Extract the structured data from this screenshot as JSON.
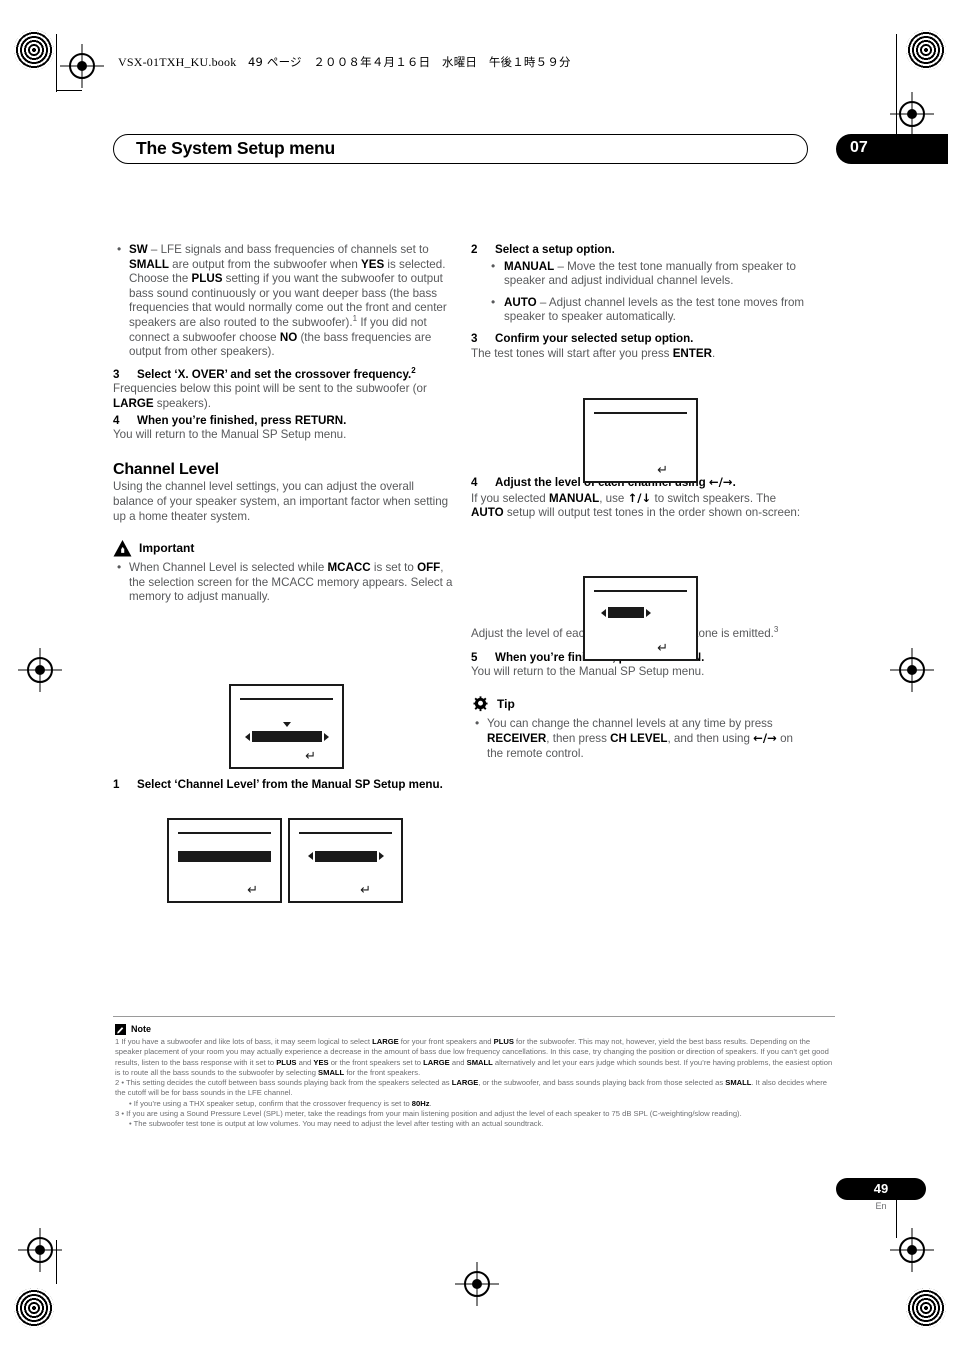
{
  "book_header": {
    "filename": "VSX-01TXH_KU.book",
    "page_label": "49 ページ",
    "date": "２００８年４月１６日　水曜日　午後１時５９分"
  },
  "chapter": {
    "title": "The System Setup menu",
    "number": "07"
  },
  "left_column": {
    "sw_bullet": {
      "term": "SW",
      "text_1": " – LFE signals and bass frequencies of channels set to ",
      "bold_1": "SMALL",
      "text_2": " are output from the subwoofer when ",
      "bold_2": "YES",
      "text_3": " is selected. Choose the ",
      "bold_3": "PLUS",
      "text_4": " setting if you want the subwoofer to output bass sound continuously or you want deeper bass (the bass frequencies that would normally come out the front and center speakers are also routed to the subwoofer).",
      "footnote_ref": "1",
      "text_5": " If you did not connect a subwoofer choose ",
      "bold_4": "NO",
      "text_6": " (the bass frequencies are output from other speakers)."
    },
    "step3": {
      "number": "3",
      "heading": "Select ‘X. OVER’ and set the crossover frequency.",
      "heading_footnote": "2",
      "body_1": "Frequencies below this point will be sent to the subwoofer (or ",
      "body_bold": "LARGE",
      "body_2": " speakers)."
    },
    "step4": {
      "number": "4",
      "heading": "When you’re finished, press RETURN.",
      "body": "You will return to the Manual SP Setup menu."
    },
    "section_title": "Channel Level",
    "section_body": "Using the channel level settings, you can adjust the overall balance of your speaker system, an important factor when setting up a home theater system.",
    "important": {
      "label": "Important",
      "bullet_1": "When Channel Level is selected while ",
      "bullet_bold_1": "MCACC",
      "bullet_2": " is set to ",
      "bullet_bold_2": "OFF",
      "bullet_3": ", the selection screen for the MCACC memory appears. Select a memory to adjust manually."
    },
    "step1": {
      "number": "1",
      "heading": "Select ‘Channel Level’ from the Manual SP Setup menu."
    }
  },
  "right_column": {
    "step2": {
      "number": "2",
      "heading": "Select a setup option.",
      "manual_term": "MANUAL",
      "manual_text": " – Move the test tone manually from speaker to speaker and adjust individual channel levels.",
      "auto_term": "AUTO",
      "auto_text": " – Adjust channel levels as the test tone moves from speaker to speaker automatically."
    },
    "step3": {
      "number": "3",
      "heading": "Confirm your selected setup option.",
      "body_1": "The test tones will start after you press ",
      "body_bold": "ENTER",
      "body_2": "."
    },
    "step4": {
      "number": "4",
      "heading_1": "Adjust the level of each channel using ",
      "heading_arrows": "←/→",
      "heading_2": ".",
      "body_1": "If you selected ",
      "body_bold_1": "MANUAL",
      "body_2": ", use ",
      "body_arrows": "↑/↓",
      "body_3": " to switch speakers. The ",
      "body_bold_2": "AUTO",
      "body_4": " setup will output test tones in the order shown on-screen:"
    },
    "after_screen_1": "Adjust the level of each speaker as the test tone is emitted.",
    "after_screen_1_footnote": "3",
    "step5": {
      "number": "5",
      "heading": "When you’re finished, press RETURN.",
      "body": "You will return to the Manual SP Setup menu."
    },
    "tip": {
      "label": "Tip",
      "bullet_1": "You can change the channel levels at any time by press ",
      "bullet_bold_1": "RECEIVER",
      "bullet_2": ", then press ",
      "bullet_bold_2": "CH LEVEL",
      "bullet_3": ", and then using ",
      "bullet_arrows": "←/→",
      "bullet_4": " on the remote control."
    }
  },
  "footnotes": {
    "label": "Note",
    "n1": {
      "marker": "1",
      "t1": "If you have a subwoofer and like lots of bass, it may seem logical to select ",
      "b1": "LARGE",
      "t2": " for your front speakers and ",
      "b2": "PLUS",
      "t3": " for the subwoofer. This may not, however, yield the best bass results. Depending on the speaker placement of your room you may actually experience a decrease in the amount of bass due low frequency cancellations. In this case, try changing the position or direction of speakers. If you can’t get good results, listen to the bass response with it set to ",
      "b3": "PLUS",
      "t4": " and ",
      "b4": "YES",
      "t5": " or the front speakers set to ",
      "b5": "LARGE",
      "t6": " and ",
      "b6": "SMALL",
      "t7": " alternatively and let your ears judge which sounds best. If you’re having problems, the easiest option is to route all the bass sounds to the subwoofer by selecting ",
      "b7": "SMALL",
      "t8": " for the front speakers."
    },
    "n2": {
      "marker": "2 •",
      "t1": "This setting decides the cutoff between bass sounds playing back from the speakers selected as ",
      "b1": "LARGE",
      "t2": ", or the subwoofer, and bass sounds playing back from those selected as ",
      "b2": "SMALL",
      "t3": ". It also decides where the cutoff will be for bass sounds in the LFE channel."
    },
    "n2b": {
      "t1": "• If you’re using a THX speaker setup, confirm that the crossover frequency is set to ",
      "b1": "80Hz",
      "t2": "."
    },
    "n3": {
      "marker": "3 •",
      "t1": "If you are using a Sound Pressure Level (SPL) meter, take the readings from your main listening position and adjust the level of each speaker to 75 dB SPL (C-weighting/slow reading)."
    },
    "n3b": {
      "t1": "• The subwoofer test tone is output at low volumes. You may need to adjust the level after testing with an actual soundtrack."
    }
  },
  "page_footer": {
    "number": "49",
    "language": "En"
  }
}
